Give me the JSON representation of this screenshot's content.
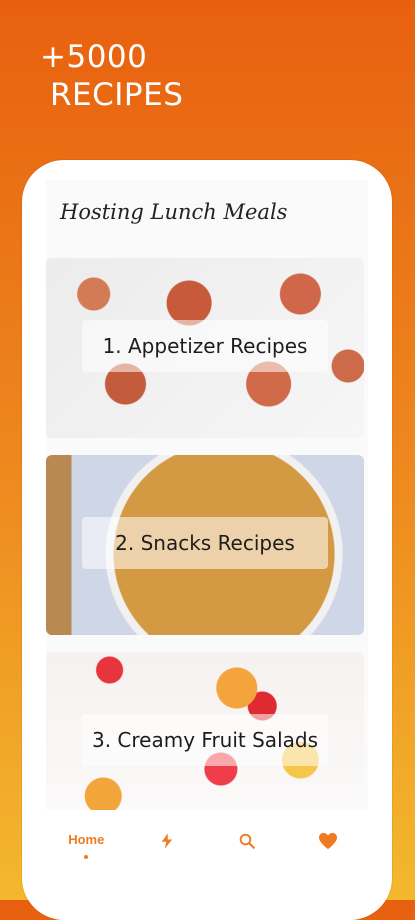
{
  "promo": {
    "line1": "+5000",
    "line2": "RECIPES"
  },
  "screen": {
    "title": "Hosting Lunch Meals"
  },
  "cards": [
    {
      "label": "1. Appetizer Recipes"
    },
    {
      "label": "2. Snacks Recipes"
    },
    {
      "label": "3. Creamy Fruit Salads"
    }
  ],
  "bottom_nav": {
    "items": [
      {
        "label": "Home",
        "icon": "home"
      },
      {
        "icon": "lightning-icon"
      },
      {
        "icon": "search-icon"
      },
      {
        "icon": "heart-icon"
      }
    ],
    "accent": "#f07a22"
  }
}
